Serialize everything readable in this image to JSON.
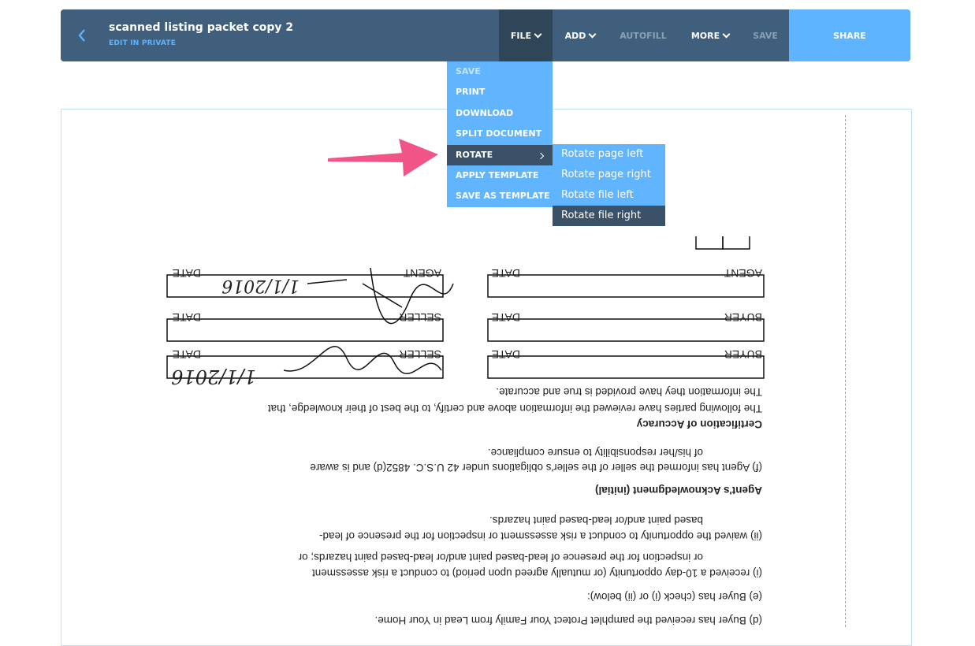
{
  "header": {
    "title": "scanned listing packet copy 2",
    "subtitle": "EDIT IN PRIVATE",
    "nav": {
      "file": "FILE",
      "add": "ADD",
      "autofill": "AUTOFILL",
      "more": "MORE",
      "save": "SAVE"
    },
    "share": "SHARE"
  },
  "file_menu": {
    "items": [
      {
        "label": "SAVE"
      },
      {
        "label": "PRINT"
      },
      {
        "label": "DOWNLOAD"
      },
      {
        "label": "SPLIT DOCUMENT"
      },
      {
        "label": "ROTATE"
      },
      {
        "label": "APPLY TEMPLATE"
      },
      {
        "label": "SAVE AS TEMPLATE"
      }
    ]
  },
  "rotate_menu": {
    "items": [
      {
        "label": "Rotate page left"
      },
      {
        "label": "Rotate page right"
      },
      {
        "label": "Rotate file left"
      },
      {
        "label": "Rotate file right"
      }
    ]
  },
  "document": {
    "labels": {
      "date": "DATE",
      "agent": "AGENT",
      "buyer": "BUYER",
      "seller": "SELLER"
    },
    "handwritten_date_1": "1/1/2016",
    "handwritten_date_2": "1/1/2016",
    "lines": [
      "The information they have provided is true and accurate.",
      "The following parties have reviewed the information above and certify, to the best of their knowledge, that",
      "Certification of Accuracy",
      "of his/her responsibility to ensure compliance.",
      "(f) Agent has informed the seller of the seller's obligations under 42 U.S.C. 4852(d) and is aware",
      "Agent's Acknowledgment (initial)",
      "based paint and/or lead-based paint hazards.",
      "(ii) waived the opportunity to conduct a risk assessment or inspection for the presence of lead-",
      "or inspection for the presence of lead-based paint and/or lead-based paint hazards; or",
      "(i) received a 10-day opportunity (or mutually agreed upon period) to conduct a risk assessment",
      "(e) Buyer has (check (i) or (ii) below):",
      "(d) Buyer has received the pamphlet Protect Your Family from Lead in Your Home."
    ]
  },
  "colors": {
    "header_bg": "#3f5f7d",
    "file_active_bg": "#2f4558",
    "accent": "#61b5ff",
    "menu_active": "#3a5168",
    "arrow": "#f0437a"
  }
}
